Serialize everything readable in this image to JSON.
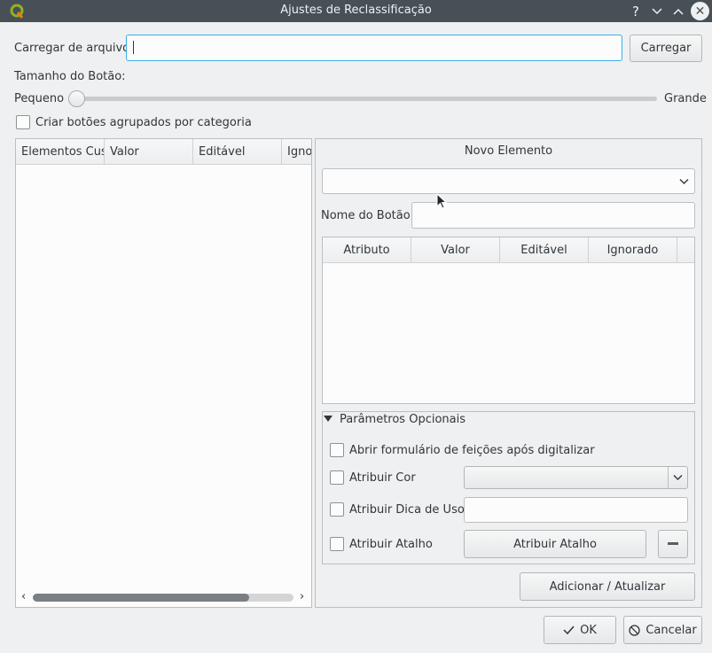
{
  "window": {
    "title": "Ajustes de Reclassificação",
    "help_glyph": "?",
    "minimize_glyph": "⌄",
    "maximize_glyph": "⌃",
    "close_glyph": "✕"
  },
  "load": {
    "label": "Carregar de arquivo",
    "value": "",
    "button": "Carregar"
  },
  "button_size": {
    "label": "Tamanho do Botão:",
    "min_label": "Pequeno",
    "max_label": "Grande",
    "level": 0
  },
  "group_checkbox": {
    "label": "Criar botões agrupados por categoria",
    "checked": false
  },
  "left_table": {
    "columns": [
      "Elementos Cus",
      "Valor",
      "Editável",
      "Igno"
    ]
  },
  "new_element": {
    "title": "Novo Elemento",
    "combo_value": "",
    "button_name_label": "Nome do Botão",
    "button_name_value": "",
    "columns": [
      "Atributo",
      "Valor",
      "Editável",
      "Ignorado"
    ]
  },
  "optional": {
    "title": "Parâmetros Opcionais",
    "open_form_label": "Abrir formulário de feições após digitalizar",
    "color_label": "Atribuir Cor",
    "tooltip_label": "Atribuir Dica de Uso",
    "shortcut_label": "Atribuir Atalho",
    "shortcut_button": "Atribuir Atalho"
  },
  "actions": {
    "add_update": "Adicionar / Atualizar",
    "ok": "OK",
    "cancel": "Cancelar"
  },
  "colors": {
    "titlebar": "#475057",
    "background": "#eff0f1",
    "focus": "#3daee9",
    "text": "#31363b"
  }
}
